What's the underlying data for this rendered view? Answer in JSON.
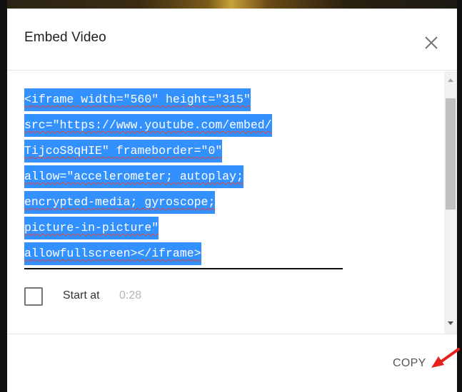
{
  "dialog": {
    "title": "Embed Video",
    "close_icon": "close-icon",
    "code_lines": [
      "<iframe width=\"560\" height=\"315\"",
      "src=\"https://www.youtube.com/embed/",
      "TijcoS8qHIE\" frameborder=\"0\"",
      "allow=\"accelerometer; autoplay;",
      "encrypted-media; gyroscope;",
      "picture-in-picture\"",
      "allowfullscreen></iframe>"
    ],
    "start_at": {
      "label": "Start at",
      "time": "0:28",
      "checked": false
    },
    "copy_label": "COPY"
  },
  "colors": {
    "selection": "#3390ff",
    "spellcheck_underline": "#e0453a",
    "annotation_arrow": "#e8201c"
  }
}
